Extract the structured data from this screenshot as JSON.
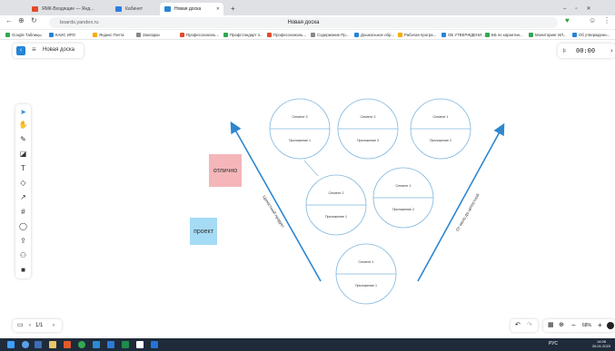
{
  "browser": {
    "tabs": [
      {
        "label": "ЯМК-Входящие — Янд...",
        "active": false
      },
      {
        "label": "Кабинет",
        "active": false
      },
      {
        "label": "Новая доска",
        "active": true
      }
    ],
    "address": "boards.yandex.ru",
    "page_title": "Новая доска",
    "bookmarks": [
      "Google Таблицы",
      "КАИС ИРО",
      "Яндекс.Почта",
      "Закладки",
      "Профессиональ...",
      "Профстандарт п...",
      "Профессиональ...",
      "Содержание Пр...",
      "Дошкольное обр...",
      "Рабочая програ...",
      "ОБ УТВЕРЖДЕНИ...",
      "ББ по карантин...",
      "Мониторинг ИЛ...",
      "Об утверждени..."
    ]
  },
  "board": {
    "title": "Новая доска",
    "timer": "00:00",
    "page_indicator": "1/1",
    "zoom": "68%",
    "sticky_notes": [
      {
        "text": "отлично",
        "color": "#f4b6b8"
      },
      {
        "text": "проект",
        "color": "#a5dbf5"
      }
    ],
    "circles": [
      {
        "top": "Сегмент 3",
        "bottom": "Приложение 1"
      },
      {
        "top": "Сегмент 2",
        "bottom": "Приложение 3"
      },
      {
        "top": "Сегмент 1",
        "bottom": "Приложение 2"
      },
      {
        "top": "Сегмент 2",
        "bottom": "Приложение 1"
      },
      {
        "top": "Сегмент 1",
        "bottom": "Приложение 2"
      },
      {
        "top": "Сегмент 1",
        "bottom": "Приложение 1"
      }
    ],
    "arrow_left_label": "Целостный продукт",
    "arrow_right_label": "От мало до целостной"
  },
  "taskbar": {
    "lang": "РУС",
    "time": "14:06",
    "date": "26.01.2023"
  },
  "colors": {
    "accent": "#2684d6",
    "circle_stroke": "#7fb6de",
    "arrow": "#2e86d0"
  },
  "icons": [
    "menu-icon",
    "select-icon",
    "hand-icon",
    "pen-icon",
    "sticker-icon",
    "text-icon",
    "shape-icon",
    "connector-icon",
    "frame-icon",
    "comment-icon",
    "upload-icon",
    "more-icon",
    "undo-icon",
    "redo-icon",
    "zoom-in-icon",
    "zoom-out-icon"
  ]
}
